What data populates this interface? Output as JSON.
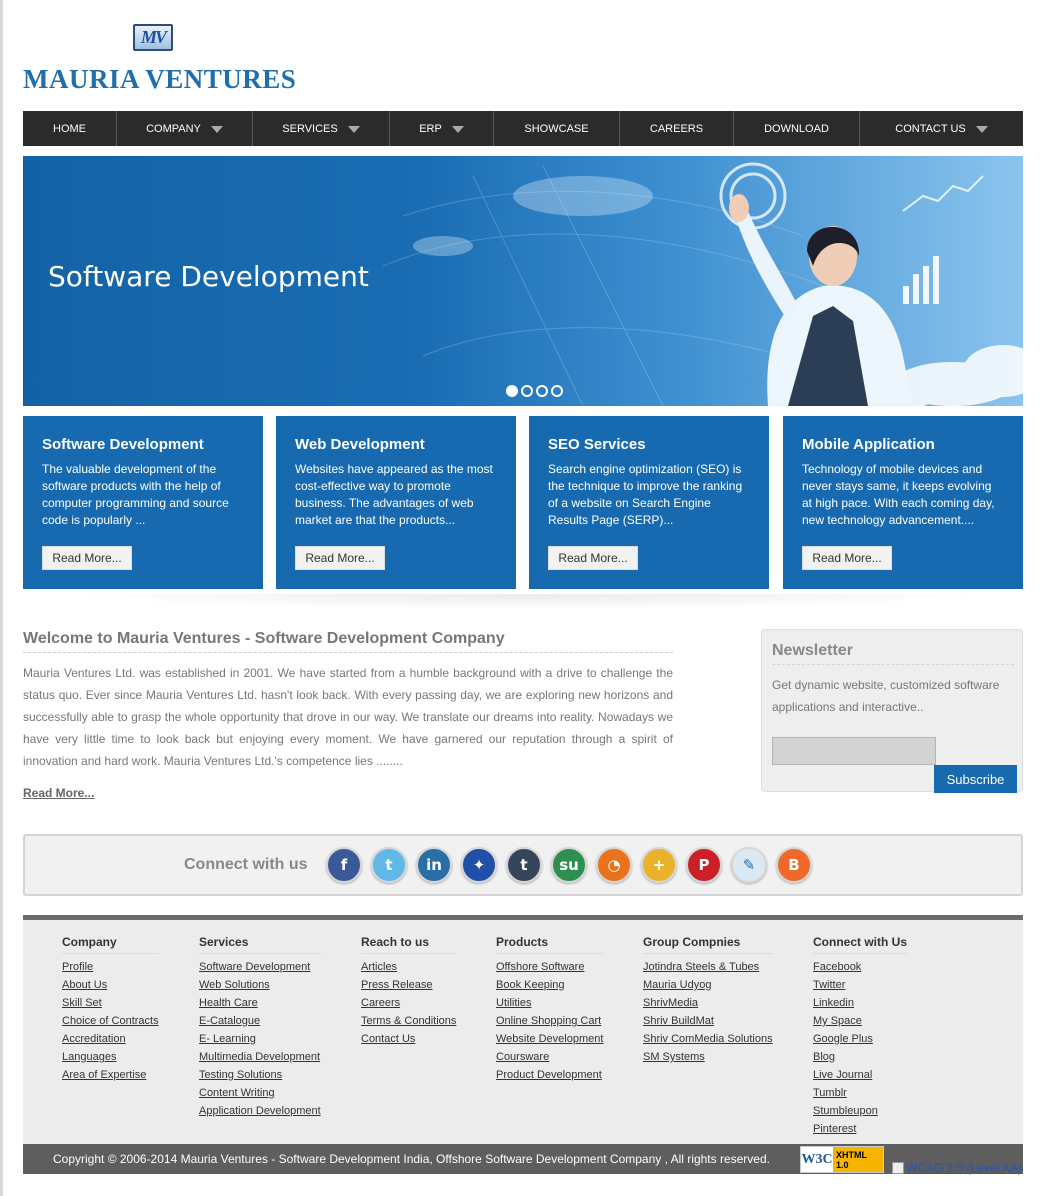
{
  "header": {
    "logo_text": "MV",
    "brand": "MAURIA VENTURES"
  },
  "nav": [
    {
      "label": "HOME",
      "dropdown": false
    },
    {
      "label": "COMPANY",
      "dropdown": true
    },
    {
      "label": "SERVICES",
      "dropdown": true
    },
    {
      "label": "ERP",
      "dropdown": true
    },
    {
      "label": "SHOWCASE",
      "dropdown": false
    },
    {
      "label": "CAREERS",
      "dropdown": false
    },
    {
      "label": "DOWNLOAD",
      "dropdown": false
    },
    {
      "label": "CONTACT US",
      "dropdown": true
    }
  ],
  "banner": {
    "title": "Software Development",
    "slide_count": 4,
    "active_slide": 1
  },
  "services": [
    {
      "title": "Software Development",
      "text": "The valuable development of the software products with the help of computer programming and source code is popularly ...",
      "button": "Read More..."
    },
    {
      "title": "Web Development",
      "text": "Websites have appeared as the most cost-effective way to promote business. The advantages of web market are that the products...",
      "button": "Read More..."
    },
    {
      "title": "SEO Services",
      "text": "Search engine optimization (SEO) is the technique to improve the ranking of a website on Search Engine Results Page (SERP)...",
      "button": "Read More..."
    },
    {
      "title": "Mobile Application",
      "text": "Technology of mobile devices and never stays same, it keeps evolving at high pace. With each coming day, new technology advancement....",
      "button": "Read More..."
    }
  ],
  "welcome": {
    "title": "Welcome to Mauria Ventures - Software Development Company",
    "text": "Mauria Ventures Ltd. was established in 2001. We have started from a humble background with a drive to challenge the status quo. Ever since Mauria Ventures Ltd. hasn't look back. With every passing day, we are exploring new horizons and successfully able to grasp the whole opportunity that drove in our way. We translate our dreams into reality. Nowadays we have very little time to look back but enjoying every moment. We have garnered our reputation through a spirit of innovation and hard work. Mauria Ventures Ltd.'s competence lies ........",
    "more": "Read More..."
  },
  "newsletter": {
    "title": "Newsletter",
    "text": "Get dynamic website, customized software applications and interactive..",
    "input_value": "",
    "button": "Subscribe"
  },
  "connect": {
    "label": "Connect with us",
    "icons": [
      {
        "name": "facebook-icon",
        "glyph": "f",
        "color": "#3b5998"
      },
      {
        "name": "twitter-icon",
        "glyph": "t",
        "color": "#5fb8e8"
      },
      {
        "name": "linkedin-icon",
        "glyph": "in",
        "color": "#2a6ea6"
      },
      {
        "name": "myspace-icon",
        "glyph": "✦",
        "color": "#1f4fa6"
      },
      {
        "name": "tumblr-icon",
        "glyph": "t",
        "color": "#35465c"
      },
      {
        "name": "stumbleupon-icon",
        "glyph": "su",
        "color": "#2f8f4e"
      },
      {
        "name": "rss-icon",
        "glyph": "◔",
        "color": "#e8731c"
      },
      {
        "name": "google-plus-icon",
        "glyph": "+",
        "color": "#e9b22a"
      },
      {
        "name": "pinterest-icon",
        "glyph": "P",
        "color": "#cb2027"
      },
      {
        "name": "live-journal-icon",
        "glyph": "✎",
        "color": "#dbe9f5"
      },
      {
        "name": "blog-icon",
        "glyph": "B",
        "color": "#ef6a2a"
      }
    ]
  },
  "footer": {
    "columns": [
      {
        "title": "Company",
        "links": [
          "Profile",
          "About Us",
          "Skill Set",
          "Choice of Contracts",
          "Accreditation",
          "Languages",
          "Area of Expertise"
        ]
      },
      {
        "title": "Services",
        "links": [
          "Software Development",
          "Web Solutions",
          "Health Care",
          "E-Catalogue",
          "E- Learning",
          "Multimedia Development",
          "Testing Solutions",
          "Content Writing",
          "Application Development"
        ]
      },
      {
        "title": "Reach to us",
        "links": [
          "Articles",
          "Press Release",
          "Careers",
          "Terms & Conditions",
          "Contact Us"
        ]
      },
      {
        "title": "Products",
        "links": [
          "Offshore Software",
          "Book Keeping",
          "Utilities",
          "Online Shopping Cart",
          "Website Development",
          "Courswarе",
          "Product Development"
        ]
      },
      {
        "title": "Group Compnies",
        "links": [
          "Jotindra Steels & Tubes",
          "Mauria Udyog",
          "ShrivMedia",
          "Shriv BuildMat",
          "Shriv ComMedia Solutions",
          "SM Systems"
        ]
      },
      {
        "title": "Connect with Us",
        "links": [
          "Facebook",
          "Twitter",
          "Linkedin",
          "My Space",
          "Google Plus",
          "Blog",
          "Live Journal",
          "Tumblr",
          "Stumbleupon",
          "Pinterest"
        ]
      }
    ],
    "copyright": "Copyright © 2006-2014 Mauria Ventures - Software Development India, Offshore Software Development Company , All rights reserved.",
    "w3c_badge": {
      "w3c": "W3C",
      "xhtml": "XHTML",
      "version": "1.0"
    },
    "wcag_link": "WCAG 2.0 (Level AA)"
  },
  "colors": {
    "brand_blue": "#176aaf",
    "nav_bg": "#2b2b2b",
    "footer_bg": "#ececec",
    "copyright_bg": "#5e5e5e"
  }
}
